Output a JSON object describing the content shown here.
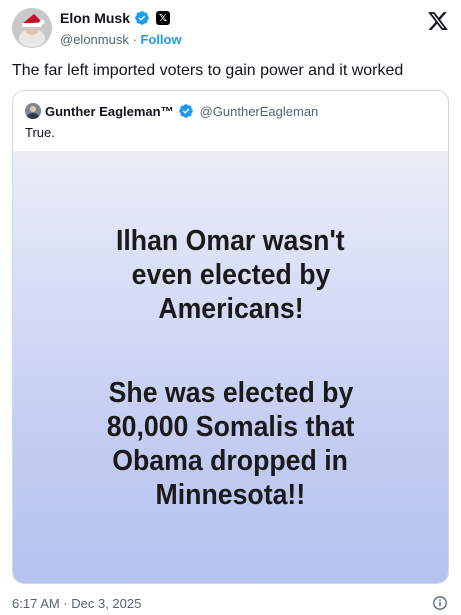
{
  "author": {
    "name": "Elon Musk",
    "handle": "@elonmusk",
    "separator": "·",
    "follow_label": "Follow"
  },
  "tweet": {
    "text": "The far left imported voters to gain power and it worked",
    "timestamp": "6:17 AM · Dec 3, 2025"
  },
  "quoted": {
    "name": "Gunther Eagleman™",
    "handle": "@GuntherEagleman",
    "text": "True.",
    "image_lines_top": [
      "Ilhan Omar wasn't",
      "even elected by",
      "Americans!"
    ],
    "image_lines_bottom": [
      "She was elected by",
      "80,000 Somalis that",
      "Obama dropped in",
      "Minnesota!!"
    ]
  },
  "icons": {
    "verified": "verified-badge-icon",
    "affiliate": "x-affiliate-badge-icon",
    "logo": "x-logo-icon",
    "info": "info-icon"
  },
  "colors": {
    "accent": "#1d9bf0",
    "secondary_text": "#536471",
    "border": "#cfd9de"
  }
}
